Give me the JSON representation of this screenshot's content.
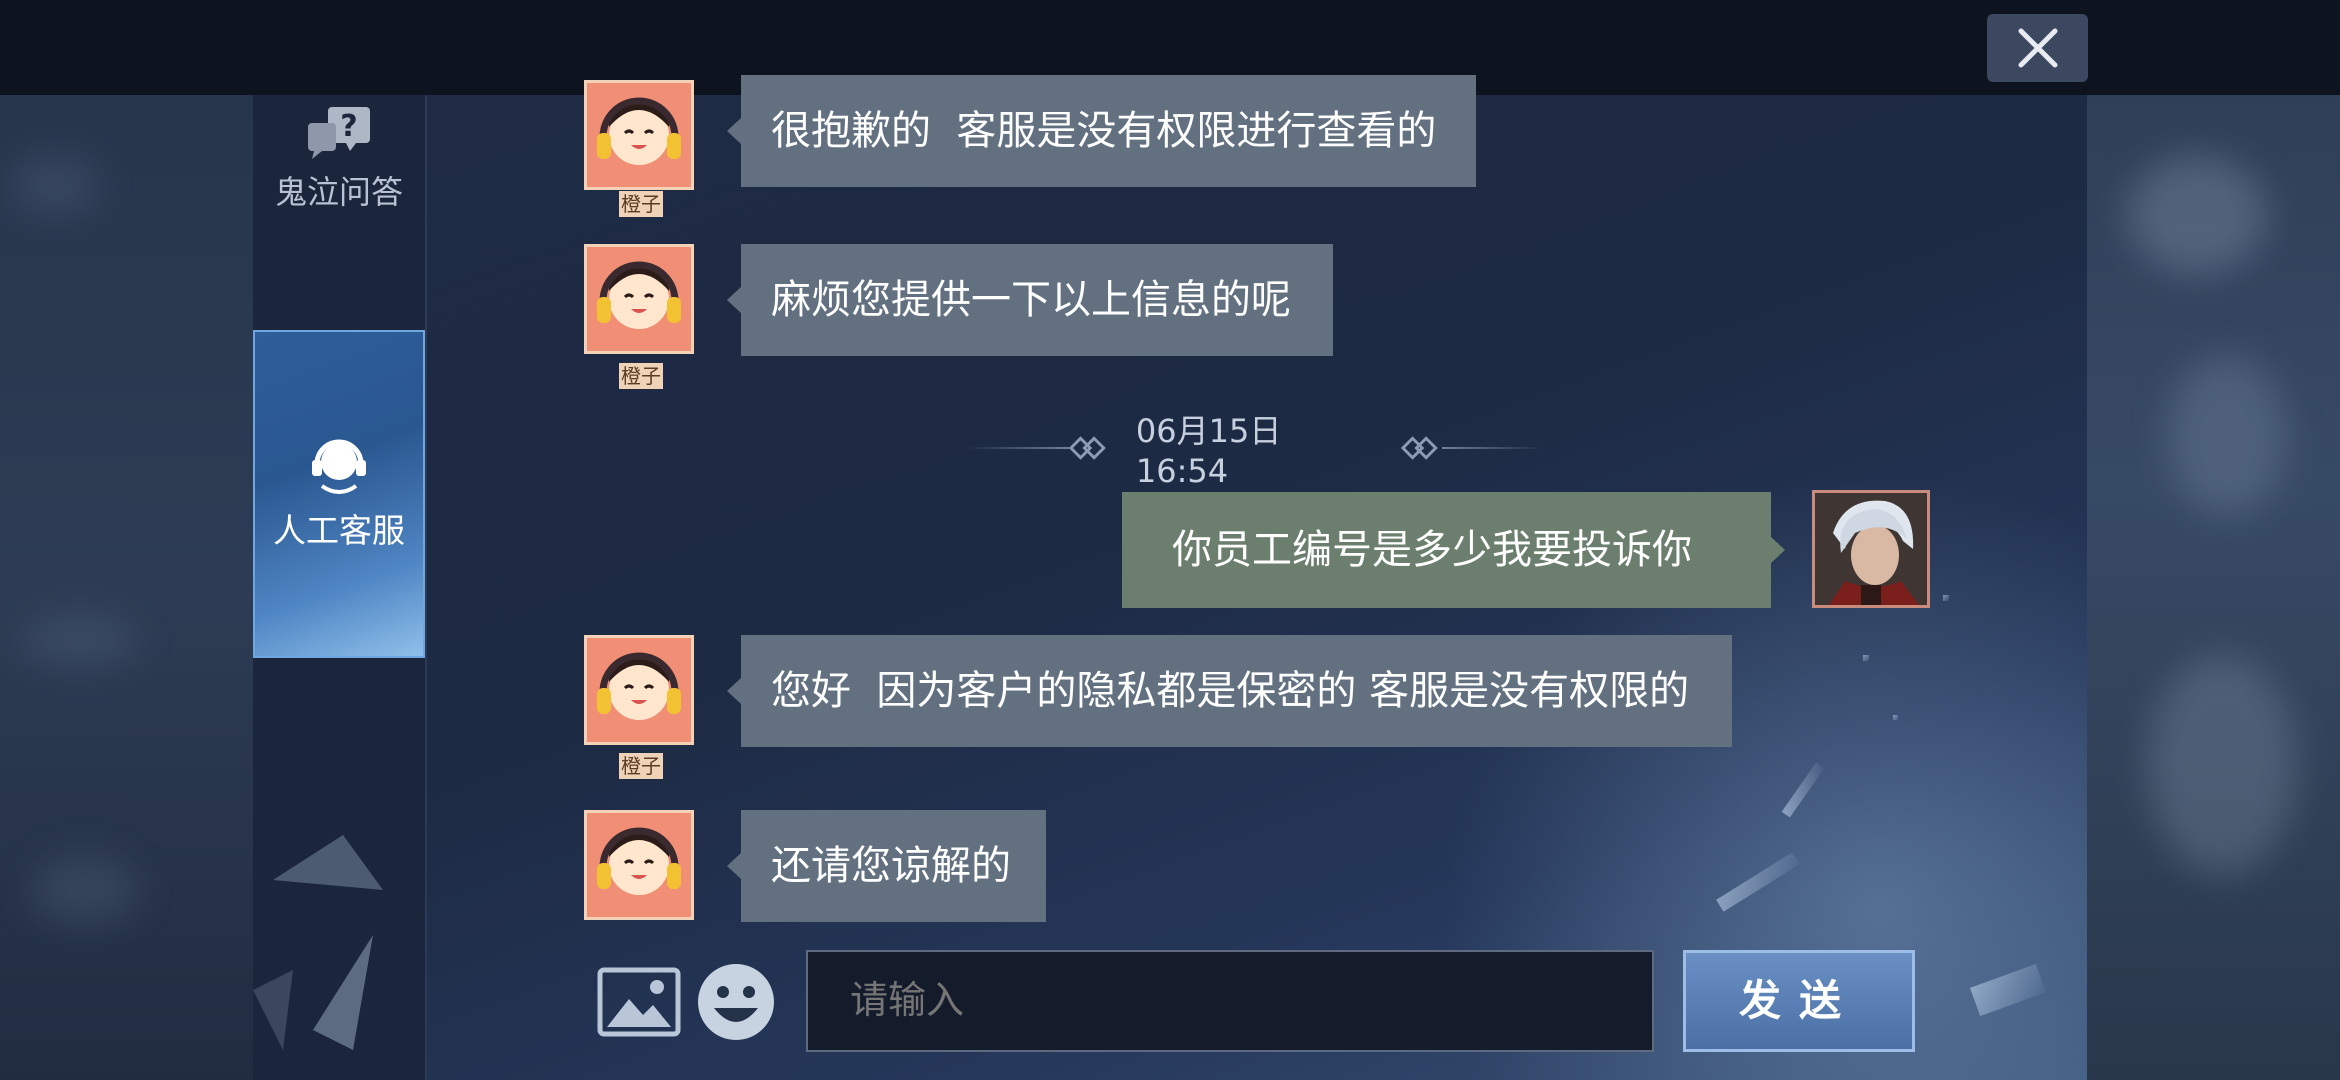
{
  "sidebar": {
    "items": [
      {
        "label": "鬼泣问答",
        "icon": "question-chat-icon"
      },
      {
        "label": "人工客服",
        "icon": "headset-icon",
        "active": true
      }
    ]
  },
  "timestamp": "06月15日 16:54",
  "messages": [
    {
      "from": "agent",
      "name": "橙子",
      "text": "很抱歉的  客服是没有权限进行查看的"
    },
    {
      "from": "agent",
      "name": "橙子",
      "text": "麻烦您提供一下以上信息的呢"
    },
    {
      "from": "user",
      "text": "你员工编号是多少我要投诉你"
    },
    {
      "from": "agent",
      "name": "橙子",
      "text": "您好  因为客户的隐私都是保密的 客服是没有权限的"
    },
    {
      "from": "agent",
      "name": "橙子",
      "text": "还请您谅解的"
    }
  ],
  "input": {
    "placeholder": "请输入"
  },
  "send_label": "发送",
  "colors": {
    "agent_bubble": "#627080",
    "user_bubble": "#6c7f6e",
    "accent_blue": "#4a70a6"
  }
}
